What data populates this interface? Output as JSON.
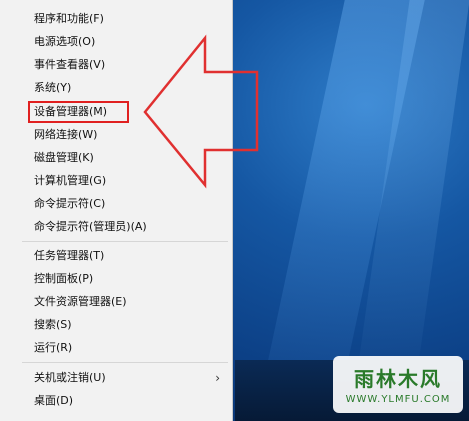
{
  "menu": {
    "items": [
      {
        "label": "程序和功能(F)"
      },
      {
        "label": "电源选项(O)"
      },
      {
        "label": "事件查看器(V)"
      },
      {
        "label": "系统(Y)"
      },
      {
        "label": "设备管理器(M)"
      },
      {
        "label": "网络连接(W)"
      },
      {
        "label": "磁盘管理(K)"
      },
      {
        "label": "计算机管理(G)"
      },
      {
        "label": "命令提示符(C)"
      },
      {
        "label": "命令提示符(管理员)(A)"
      },
      {
        "label": "任务管理器(T)"
      },
      {
        "label": "控制面板(P)"
      },
      {
        "label": "文件资源管理器(E)"
      },
      {
        "label": "搜索(S)"
      },
      {
        "label": "运行(R)"
      },
      {
        "label": "关机或注销(U)"
      },
      {
        "label": "桌面(D)"
      }
    ],
    "submenu_chevron": "›"
  },
  "annotation": {
    "highlight_color": "#e02020",
    "arrow_color": "#e03030"
  },
  "watermark": {
    "title": "雨林木风",
    "url": "WWW.YLMFU.COM"
  }
}
